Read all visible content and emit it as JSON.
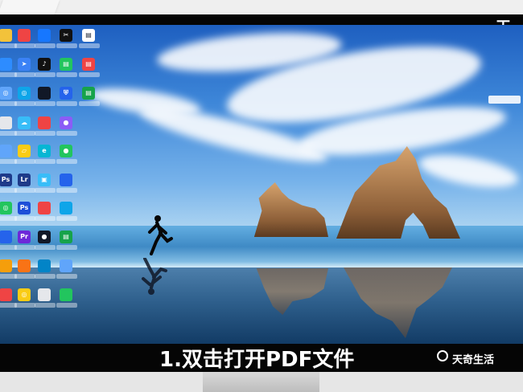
{
  "watermark": {
    "top_right": "天奇",
    "brand": "天奇生活"
  },
  "caption": {
    "text": "1.双击打开PDF文件"
  },
  "desktop": {
    "wallpaper": "beach-rock-wallpaper",
    "icons": [
      {
        "name": "desktop-icon-1",
        "icon": "app-icon",
        "color": "#f3c23a",
        "label": ""
      },
      {
        "name": "desktop-icon-2",
        "icon": "app-icon",
        "color": "#ef4444",
        "label": ""
      },
      {
        "name": "desktop-icon-3",
        "icon": "app-icon",
        "color": "#1677ff",
        "label": ""
      },
      {
        "name": "desktop-icon-4",
        "icon": "capcut-icon",
        "color": "#111111",
        "label": ""
      },
      {
        "name": "desktop-icon-5",
        "icon": "document-icon",
        "color": "#ffffff",
        "label": ""
      },
      {
        "name": "desktop-icon-6",
        "icon": "app-icon",
        "color": "#2d8cff",
        "label": ""
      },
      {
        "name": "desktop-icon-7",
        "icon": "paper-plane-icon",
        "color": "#3b82f6",
        "label": ""
      },
      {
        "name": "desktop-icon-8",
        "icon": "tiktok-icon",
        "color": "#111111",
        "label": ""
      },
      {
        "name": "desktop-icon-9",
        "icon": "document-icon",
        "color": "#22c55e",
        "label": ""
      },
      {
        "name": "desktop-icon-10",
        "icon": "pdf-icon",
        "color": "#ef4444",
        "label": ""
      },
      {
        "name": "desktop-icon-11",
        "icon": "browser-icon",
        "color": "#60a5fa",
        "label": ""
      },
      {
        "name": "desktop-icon-12",
        "icon": "browser-icon",
        "color": "#0ea5e9",
        "label": ""
      },
      {
        "name": "desktop-icon-13",
        "icon": "app-icon",
        "color": "#111827",
        "label": ""
      },
      {
        "name": "desktop-icon-14",
        "icon": "shield-icon",
        "color": "#2563eb",
        "label": ""
      },
      {
        "name": "desktop-icon-15",
        "icon": "document-icon",
        "color": "#16a34a",
        "label": ""
      },
      {
        "name": "desktop-icon-16",
        "icon": "app-icon",
        "color": "#e5e7eb",
        "label": ""
      },
      {
        "name": "desktop-icon-17",
        "icon": "cloud-icon",
        "color": "#38bdf8",
        "label": ""
      },
      {
        "name": "desktop-icon-18",
        "icon": "app-icon",
        "color": "#ef4444",
        "label": ""
      },
      {
        "name": "desktop-icon-19",
        "icon": "color-wheel-icon",
        "color": "#8b5cf6",
        "label": ""
      },
      {
        "name": "desktop-icon-20",
        "icon": "app-icon",
        "color": "#60a5fa",
        "label": ""
      },
      {
        "name": "desktop-icon-21",
        "icon": "folder-icon",
        "color": "#facc15",
        "label": ""
      },
      {
        "name": "desktop-icon-22",
        "icon": "edge-icon",
        "color": "#06b6d4",
        "label": ""
      },
      {
        "name": "desktop-icon-23",
        "icon": "chat-icon",
        "color": "#22c55e",
        "label": ""
      },
      {
        "name": "desktop-icon-24",
        "icon": "photoshop-icon",
        "color": "#1e3a8a",
        "label": ""
      },
      {
        "name": "desktop-icon-25",
        "icon": "lightroom-icon",
        "color": "#1e3a8a",
        "label": ""
      },
      {
        "name": "desktop-icon-26",
        "icon": "image-icon",
        "color": "#38bdf8",
        "label": ""
      },
      {
        "name": "desktop-icon-27",
        "icon": "app-icon",
        "color": "#2563eb",
        "label": ""
      },
      {
        "name": "desktop-icon-28",
        "icon": "browser-icon",
        "color": "#22c55e",
        "label": ""
      },
      {
        "name": "desktop-icon-29",
        "icon": "photoshop-icon",
        "color": "#1d4ed8",
        "label": ""
      },
      {
        "name": "desktop-icon-30",
        "icon": "app-icon",
        "color": "#ef4444",
        "label": ""
      },
      {
        "name": "desktop-icon-31",
        "icon": "app-icon",
        "color": "#0ea5e9",
        "label": ""
      },
      {
        "name": "desktop-icon-32",
        "icon": "app-icon",
        "color": "#2563eb",
        "label": ""
      },
      {
        "name": "desktop-icon-33",
        "icon": "premiere-icon",
        "color": "#6d28d9",
        "label": ""
      },
      {
        "name": "desktop-icon-34",
        "icon": "penguin-icon",
        "color": "#111827",
        "label": ""
      },
      {
        "name": "desktop-icon-35",
        "icon": "document-icon",
        "color": "#16a34a",
        "label": ""
      },
      {
        "name": "desktop-icon-36",
        "icon": "app-icon",
        "color": "#f59e0b",
        "label": ""
      },
      {
        "name": "desktop-icon-37",
        "icon": "app-icon",
        "color": "#f97316",
        "label": ""
      },
      {
        "name": "desktop-icon-38",
        "icon": "app-icon",
        "color": "#0284c7",
        "label": ""
      },
      {
        "name": "desktop-icon-39",
        "icon": "app-icon",
        "color": "#60a5fa",
        "label": ""
      },
      {
        "name": "desktop-icon-40",
        "icon": "app-icon",
        "color": "#ef4444",
        "label": ""
      },
      {
        "name": "desktop-icon-41",
        "icon": "chrome-icon",
        "color": "#facc15",
        "label": ""
      },
      {
        "name": "desktop-icon-42",
        "icon": "app-icon",
        "color": "#e5e7eb",
        "label": ""
      },
      {
        "name": "desktop-icon-43",
        "icon": "app-icon",
        "color": "#22c55e",
        "label": ""
      }
    ]
  }
}
